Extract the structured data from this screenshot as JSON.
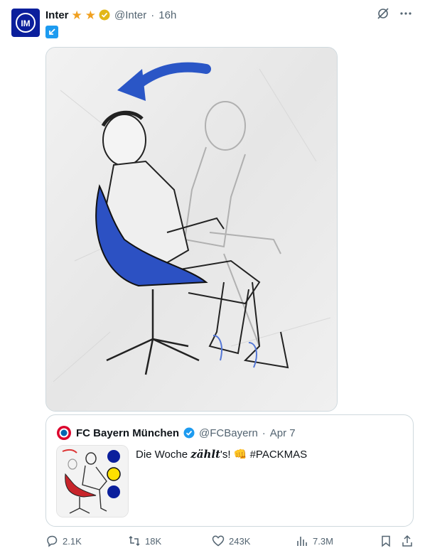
{
  "post": {
    "author_name": "Inter",
    "handle": "@Inter",
    "separator": "·",
    "time": "16h",
    "colors": {
      "accent": "#1d9bf0",
      "brand": "#0b1f9c",
      "star": "#f0a020",
      "muted": "#536471"
    }
  },
  "quoted": {
    "author_name": "FC Bayern München",
    "handle": "@FCBayern",
    "separator": "·",
    "date": "Apr 7",
    "text_before": "Die Woche ",
    "text_emph": "zählt",
    "text_after": "'s! 👊 #PACKMAS"
  },
  "actions": {
    "replies": "2.1K",
    "reposts": "18K",
    "likes": "243K",
    "views": "7.3M"
  }
}
